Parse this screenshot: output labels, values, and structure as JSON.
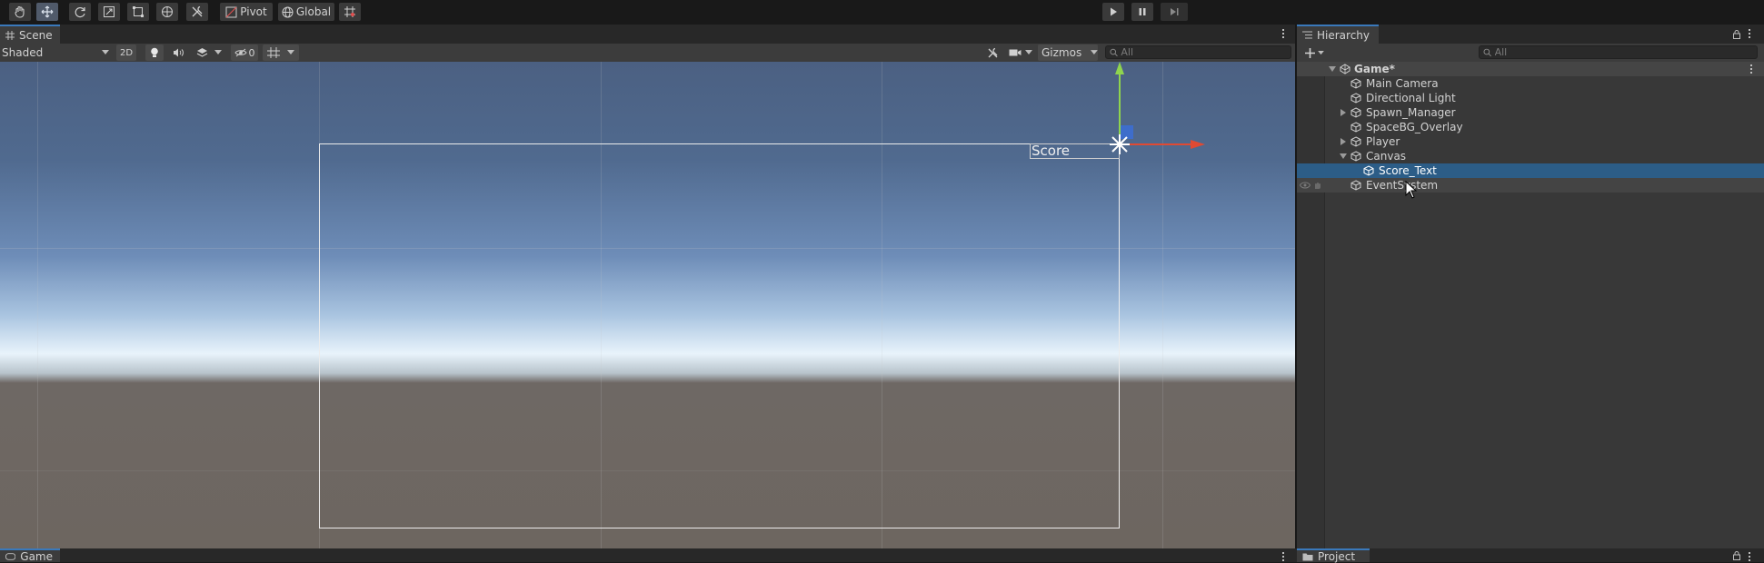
{
  "toolbar": {
    "tools": [
      "hand-tool",
      "move-tool",
      "rotate-tool",
      "scale-tool",
      "rect-tool",
      "transform-tool",
      "custom-tool"
    ],
    "pivot_label": "Pivot",
    "global_label": "Global",
    "play": "play-icon",
    "pause": "pause-icon",
    "step": "step-icon"
  },
  "scene": {
    "tab_label": "Scene",
    "draw_mode": "Shaded",
    "mode_2d": "2D",
    "hidden_count": "0",
    "gizmos_label": "Gizmos",
    "search_placeholder": "All",
    "score_text": "Score"
  },
  "hierarchy": {
    "tab_label": "Hierarchy",
    "search_placeholder": "All",
    "scene_name": "Game*",
    "items": [
      {
        "label": "Main Camera"
      },
      {
        "label": "Directional Light"
      },
      {
        "label": "Spawn_Manager"
      },
      {
        "label": "SpaceBG_Overlay"
      },
      {
        "label": "Player"
      },
      {
        "label": "Canvas"
      },
      {
        "label": "Score_Text"
      },
      {
        "label": "EventSystem"
      }
    ]
  },
  "bottom": {
    "game_tab": "Game",
    "project_tab": "Project"
  },
  "colors": {
    "selection": "#2c5d87",
    "accent_tab": "#3a79bb",
    "gizmo_y": "#8fd44e",
    "gizmo_x": "#e04a33",
    "gizmo_z": "#3b6fd6"
  }
}
